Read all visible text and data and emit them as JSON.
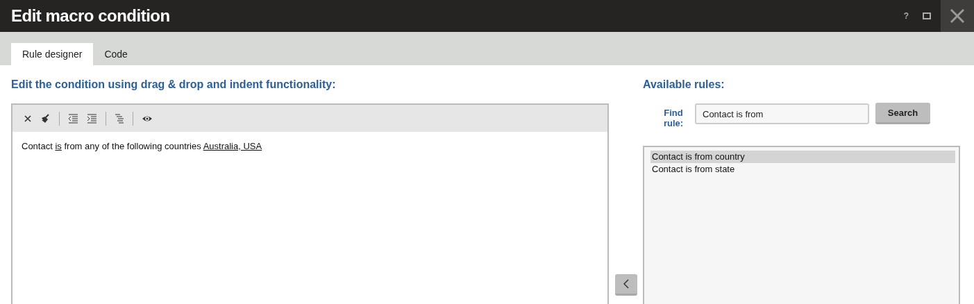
{
  "window": {
    "title": "Edit macro condition",
    "help": "?"
  },
  "tabs": [
    {
      "label": "Rule designer",
      "selected": true
    },
    {
      "label": "Code",
      "selected": false
    }
  ],
  "editor": {
    "heading": "Edit the condition using drag & drop and indent functionality:",
    "condition": [
      {
        "text": "Contact",
        "link": false
      },
      {
        "text": "is",
        "link": true
      },
      {
        "text": "from any of the following countries",
        "link": false
      },
      {
        "text": "Australia, USA",
        "link": true
      }
    ]
  },
  "rules": {
    "heading": "Available rules:",
    "find_label": "Find rule:",
    "search_value": "Contact is from",
    "search_button": "Search",
    "items": [
      {
        "label": "Contact is from country",
        "selected": true
      },
      {
        "label": "Contact is from state",
        "selected": false
      }
    ]
  }
}
